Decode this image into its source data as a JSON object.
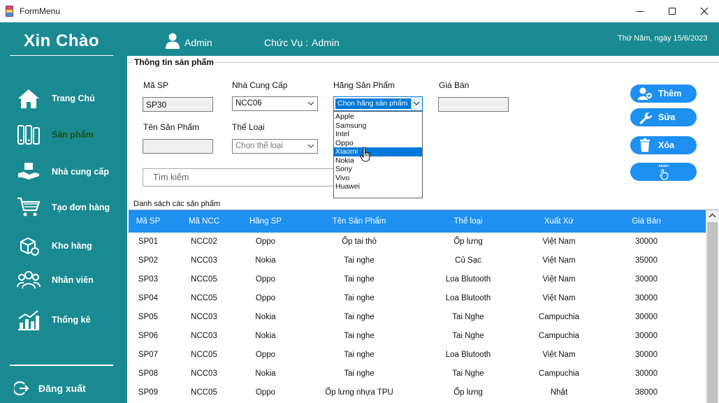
{
  "window": {
    "title": "FormMenu"
  },
  "header": {
    "greeting": "Xin Chào",
    "user_name": "Admin",
    "role_label": "Chức Vụ :",
    "role_value": "Admin",
    "date": "Thứ Năm, ngày 15/6/2023"
  },
  "sidebar": {
    "items": [
      {
        "label": "Trang Chủ",
        "icon": "home-icon"
      },
      {
        "label": "Sản phẩm",
        "icon": "products-icon",
        "active": true
      },
      {
        "label": "Nhà cung cấp",
        "icon": "supplier-icon"
      },
      {
        "label": "Tạo đơn hàng",
        "icon": "cart-icon"
      },
      {
        "label": "Kho hàng",
        "icon": "warehouse-icon"
      },
      {
        "label": "Nhân viên",
        "icon": "staff-icon"
      },
      {
        "label": "Thống kê",
        "icon": "stats-icon"
      }
    ],
    "logout_label": "Đăng xuất"
  },
  "form": {
    "group_title": "Thông tin sản phẩm",
    "ma_sp_label": "Mã SP",
    "ma_sp_value": "SP30",
    "ncc_label": "Nhà Cung Cấp",
    "ncc_value": "NCC06",
    "hang_label": "Hãng Sản Phẩm",
    "hang_value": "Chọn hãng sản phẩm",
    "gia_label": "Giá Bán",
    "gia_value": "",
    "ten_label": "Tên Sản Phẩm",
    "ten_value": "",
    "theloai_label": "Thể Loại",
    "theloai_placeholder": "Chọn thể loại",
    "search_placeholder": "Tìm kiếm"
  },
  "brand_dropdown": {
    "options": [
      "Apple",
      "Samsung",
      "Intel",
      "Oppo",
      "Xiaomi",
      "Nokia",
      "Sony",
      "Vivo",
      "Huawei"
    ],
    "highlighted": "Xiaomi"
  },
  "actions": {
    "add_label": "Thêm",
    "edit_label": "Sửa",
    "delete_label": "Xóa",
    "reset_icon_text": "RESET"
  },
  "table": {
    "caption": "Danh sách các sản phẩm",
    "columns": [
      "Mã SP",
      "Mã NCC",
      "Hãng SP",
      "Tên Sản Phẩm",
      "Thể loại",
      "Xuất Xứ",
      "Giá Bán"
    ],
    "rows": [
      [
        "SP01",
        "NCC02",
        "Oppo",
        "Ốp tai thỏ",
        "Ốp lưng",
        "Việt Nam",
        "30000"
      ],
      [
        "SP02",
        "NCC03",
        "Nokia",
        "Tai nghe",
        "Củ Sạc",
        "Việt Nam",
        "35000"
      ],
      [
        "SP03",
        "NCC05",
        "Oppo",
        "Tai nghe",
        "Loa Blutooth",
        "Việt Nam",
        "30000"
      ],
      [
        "SP04",
        "NCC05",
        "Oppo",
        "Tai nghe",
        "Loa Blutooth",
        "Việt Nam",
        "30000"
      ],
      [
        "SP05",
        "NCC03",
        "Nokia",
        "Tai nghe",
        "Tai Nghe",
        "Campuchia",
        "30000"
      ],
      [
        "SP06",
        "NCC03",
        "Nokia",
        "Tai nghe",
        "Tai Nghe",
        "Campuchia",
        "30000"
      ],
      [
        "SP07",
        "NCC05",
        "Oppo",
        "Tai nghe",
        "Loa Blutooth",
        "Việt Nam",
        "30000"
      ],
      [
        "SP08",
        "NCC03",
        "Nokia",
        "Tai nghe",
        "Tai Nghe",
        "Campuchia",
        "30000"
      ],
      [
        "SP09",
        "NCC05",
        "Oppo",
        "Ốp lưng nhựa TPU",
        "Ốp lưng",
        "Nhật",
        "38000"
      ]
    ]
  },
  "colors": {
    "teal": "#1a8a92",
    "accent_blue": "#1e90f0",
    "selection_blue": "#0078d7",
    "active_nav_text": "#1a4d1a"
  }
}
